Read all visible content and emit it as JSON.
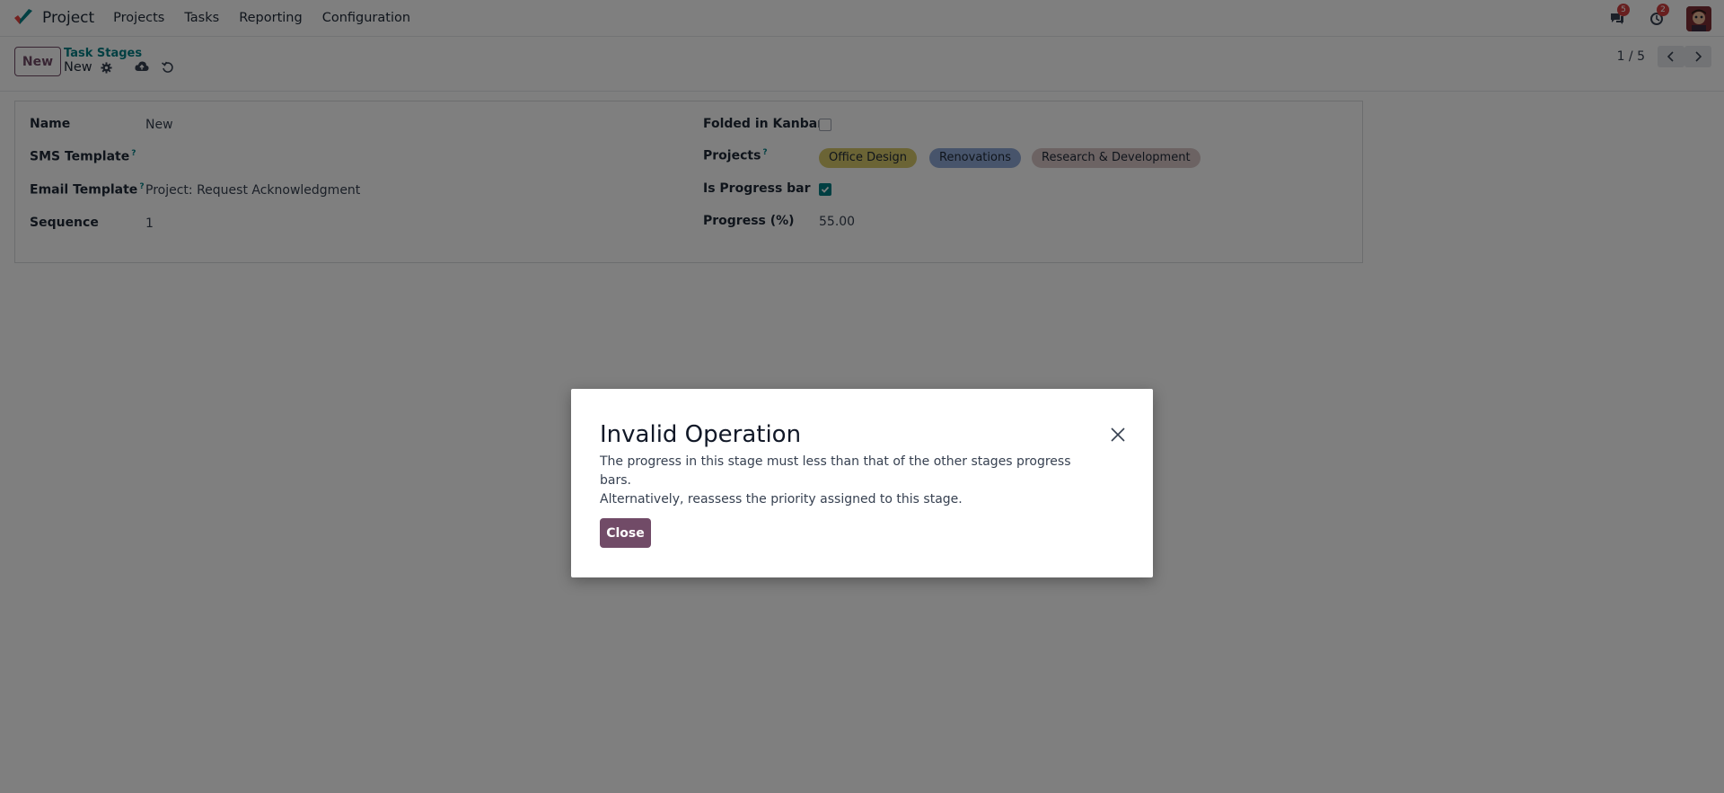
{
  "navbar": {
    "app_name": "Project",
    "menu": [
      "Projects",
      "Tasks",
      "Reporting",
      "Configuration"
    ],
    "messages_count": "5",
    "activities_count": "2"
  },
  "control_panel": {
    "new_label": "New",
    "breadcrumb": "Task Stages",
    "record_name": "New",
    "pager": "1 / 5"
  },
  "form": {
    "name_label": "Name",
    "name_value": "New",
    "sms_label": "SMS Template",
    "email_label": "Email Template",
    "email_value": "Project: Request Acknowledgment",
    "sequence_label": "Sequence",
    "sequence_value": "1",
    "folded_label": "Folded in Kanban",
    "folded_checked": false,
    "projects_label": "Projects",
    "projects": [
      {
        "name": "Office Design",
        "color": "#d6c86a"
      },
      {
        "name": "Renovations",
        "color": "#8fa9d6"
      },
      {
        "name": "Research & Development",
        "color": "#d8c6c6"
      }
    ],
    "progress_bar_label": "Is Progress bar",
    "progress_bar_checked": true,
    "progress_label": "Progress (%)",
    "progress_value": "55.00",
    "help_mark": "?"
  },
  "dialog": {
    "title": "Invalid Operation",
    "line1": "The progress in this stage must less than that of the other stages progress bars.",
    "line2": "Alternatively, reassess the priority assigned to this stage.",
    "close_label": "Close"
  },
  "colors": {
    "primary": "#714b67",
    "accent": "#017e84"
  }
}
